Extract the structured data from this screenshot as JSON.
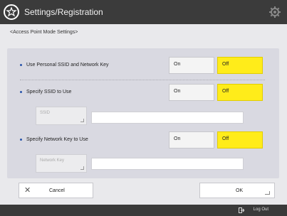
{
  "header": {
    "title": "Settings/Registration",
    "app_icon": "settings-app-icon",
    "gear_icon": "gear-icon"
  },
  "breadcrumb": "<Access Point Mode Settings>",
  "rows": [
    {
      "label": "Use Personal SSID and Network Key",
      "on": "On",
      "off": "Off",
      "selected": "Off"
    },
    {
      "label": "Specify SSID to Use",
      "on": "On",
      "off": "Off",
      "selected": "Off"
    },
    {
      "label": "Specify Network Key to Use",
      "on": "On",
      "off": "Off",
      "selected": "Off"
    }
  ],
  "ssid_button": "SSID",
  "network_key_button": "Network Key",
  "cancel_label": "Cancel",
  "ok_label": "OK",
  "footer": {
    "logout_label": "Log Out"
  },
  "colors": {
    "selected": "#ffec1a",
    "titlebar": "#3b3b3b",
    "panel": "#d9d9e1"
  }
}
